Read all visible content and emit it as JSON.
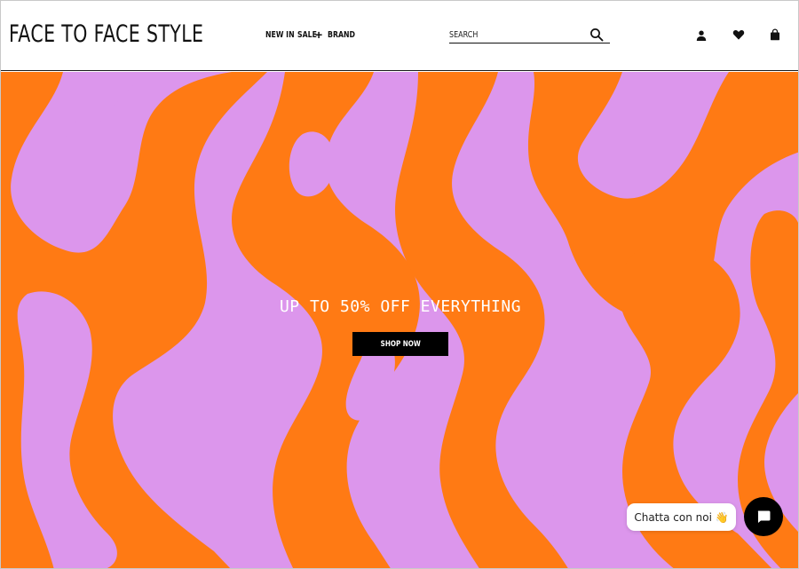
{
  "header": {
    "logo": "FACE TO FACE STYLE",
    "nav": {
      "new_in": "NEW IN",
      "sale": "SALE",
      "plus": "+",
      "brand": "BRAND"
    },
    "search": {
      "placeholder": "SEARCH"
    },
    "icons": [
      "user-icon",
      "heart-icon",
      "bag-icon",
      "search-icon"
    ]
  },
  "hero": {
    "headline": "UP TO 50% OFF EVERYTHING",
    "cta": "SHOP NOW",
    "colors": {
      "lilac": "#dc96ec",
      "orange": "#ff7a14"
    }
  },
  "chat": {
    "bubble_text": "Chatta con noi 👋",
    "button_icon": "chat-icon"
  }
}
